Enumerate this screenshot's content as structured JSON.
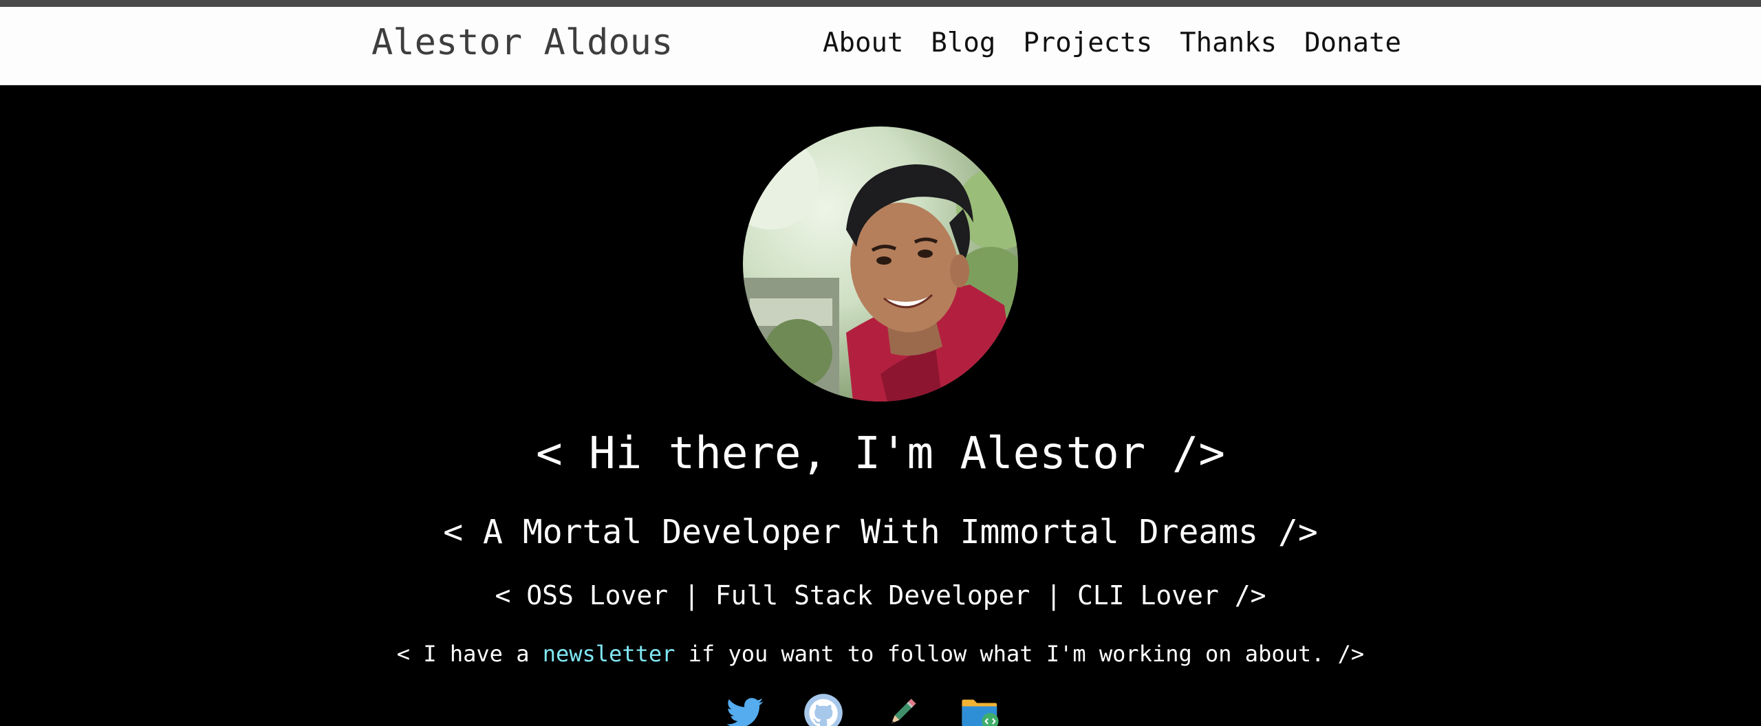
{
  "header": {
    "site_title": "Alestor Aldous",
    "nav": [
      "About",
      "Blog",
      "Projects",
      "Thanks",
      "Donate"
    ]
  },
  "hero": {
    "greeting": "< Hi there, I'm Alestor />",
    "tagline": "< A Mortal Developer With Immortal Dreams />",
    "roles": "< OSS Lover | Full Stack Developer | CLI Lover />",
    "newsletter_before": "< I have a ",
    "newsletter_link": "newsletter",
    "newsletter_after": " if you want to follow what I'm working on about. />"
  },
  "socials": [
    {
      "icon": "twitter-icon"
    },
    {
      "icon": "github-icon"
    },
    {
      "icon": "pencil-icon"
    },
    {
      "icon": "code-folder-icon"
    }
  ],
  "colors": {
    "background": "#000000",
    "header_bg": "#fdfdfd",
    "link": "#7fe7f2",
    "twitter": "#55acee"
  }
}
